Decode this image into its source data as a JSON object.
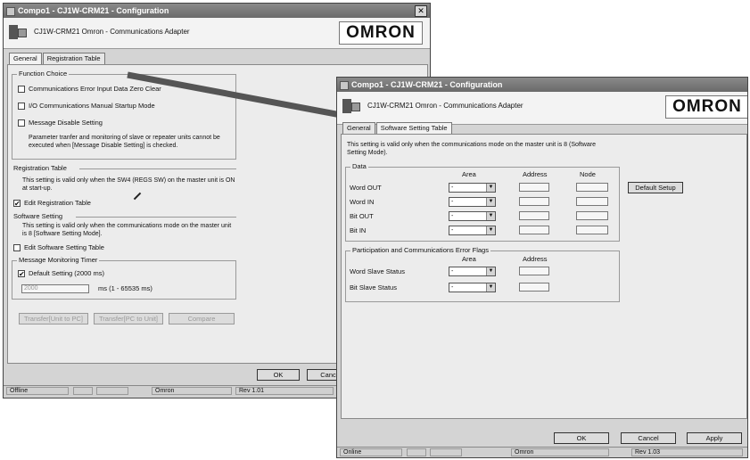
{
  "back_window": {
    "title": "Compo1 - CJ1W-CRM21 - Configuration",
    "close_label": "✕",
    "unit_text": "CJ1W-CRM21  Omron - Communications Adapter",
    "logo": "OMRON",
    "tabs": [
      "General",
      "Registration Table"
    ],
    "function_choice": {
      "title": "Function Choice",
      "items": [
        "Communications Error Input Data Zero Clear",
        "I/O Communications Manual Startup Mode",
        "Message Disable Setting"
      ],
      "note": "Parameter tranfer and monitoring of slave or repeater units cannot be executed when [Message Disable Setting] is checked."
    },
    "registration_table": {
      "title": "Registration Table",
      "note": "This setting is valid only when the SW4 (REGS SW) on the master unit is ON at start-up.",
      "checkbox": "Edit Registration Table",
      "checked": true
    },
    "software_setting": {
      "title": "Software Setting",
      "note": "This setting is valid only when the communications mode on the master unit is 8 [Software Setting Mode].",
      "checkbox": "Edit Software Setting Table"
    },
    "message_timer": {
      "title": "Message Monitoring Timer",
      "checkbox": "Default Setting (2000 ms)",
      "checked": true,
      "value": "2000",
      "range": "ms (1 - 65535 ms)"
    },
    "buttons": [
      "Transfer[Unit to PC]",
      "Transfer[PC to Unit]",
      "Compare"
    ],
    "ok": "OK",
    "cancel": "Canc",
    "status": [
      "Offline",
      "Omron",
      "Rev 1.01"
    ]
  },
  "front_window": {
    "title": "Compo1 - CJ1W-CRM21 - Configuration",
    "unit_text": "CJ1W-CRM21   Omron - Communications Adapter",
    "logo": "OMRON",
    "tabs": [
      "General",
      "Software Setting Table"
    ],
    "note": "This setting is valid only when the communications mode on the master unit is 8 (Software Setting Mode).",
    "data_group": {
      "title": "Data",
      "headers": [
        "Area",
        "Address",
        "Node"
      ],
      "rows": [
        {
          "label": "Word OUT",
          "area": "-"
        },
        {
          "label": "Word IN",
          "area": "-"
        },
        {
          "label": "Bit OUT",
          "area": "-"
        },
        {
          "label": "Bit IN",
          "area": "-"
        }
      ]
    },
    "default_setup": "Default Setup",
    "flags_group": {
      "title": "Participation and Communications Error Flags",
      "headers": [
        "Area",
        "Address"
      ],
      "rows": [
        {
          "label": "Word Slave Status",
          "area": "-"
        },
        {
          "label": "Bit Slave Status",
          "area": "-"
        }
      ]
    },
    "ok": "OK",
    "cancel": "Cancel",
    "apply": "Apply",
    "status": [
      "Online",
      "Omron",
      "Rev 1.03"
    ]
  }
}
